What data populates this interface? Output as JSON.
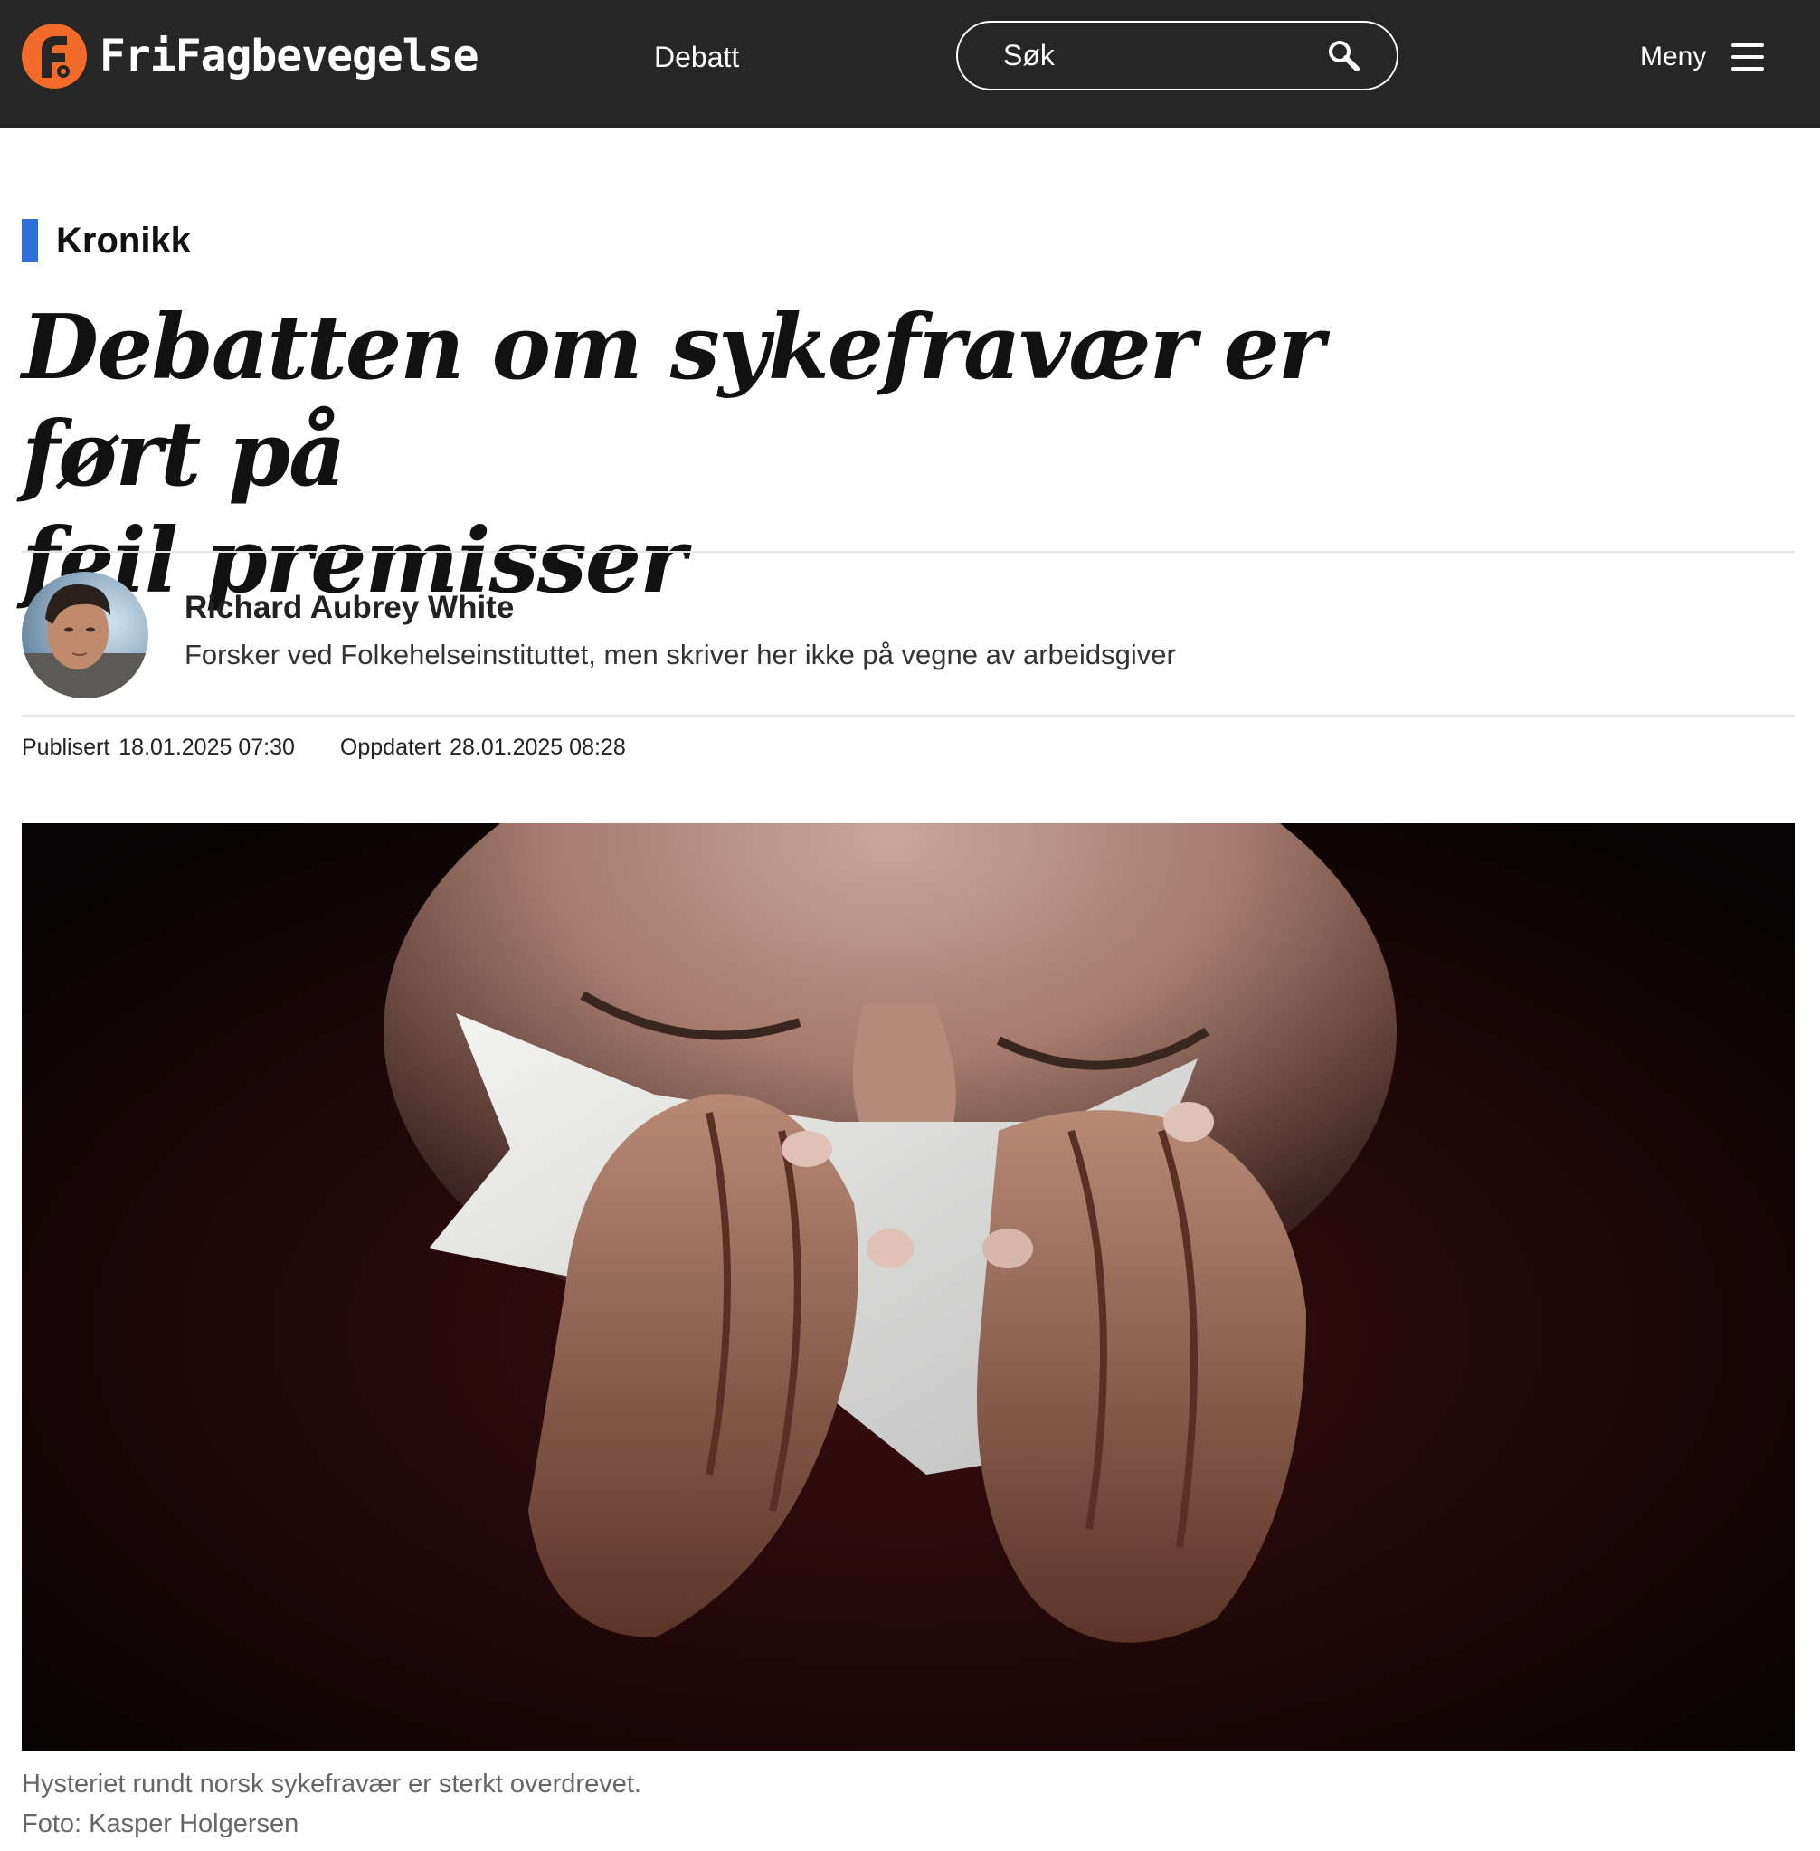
{
  "header": {
    "logo_text": "FriFagbevegelse",
    "nav_debatt": "Debatt",
    "search_placeholder": "Søk",
    "menu_label": "Meny"
  },
  "article": {
    "kicker": "Kronikk",
    "headline_line1": "Debatten om sykefravær er ført på",
    "headline_line2": "feil premisser",
    "author_name": "Richard Aubrey White",
    "author_role": "Forsker ved Folkehelseinstituttet, men skriver her ikke på vegne av arbeidsgiver",
    "published_label": "Publisert",
    "published_value": "18.01.2025 07:30",
    "updated_label": "Oppdatert",
    "updated_value": "28.01.2025 08:28",
    "image_caption": "Hysteriet rundt norsk sykefravær er sterkt overdrevet.",
    "image_credit": "Foto: Kasper Holgersen"
  },
  "colors": {
    "header_bg": "#262626",
    "logo_orange": "#f26b2a",
    "kicker_accent": "#2f6fdc"
  },
  "icons": {
    "logo": "frifagbevegelse-logo-icon",
    "search": "search-icon",
    "menu": "hamburger-menu-icon"
  }
}
